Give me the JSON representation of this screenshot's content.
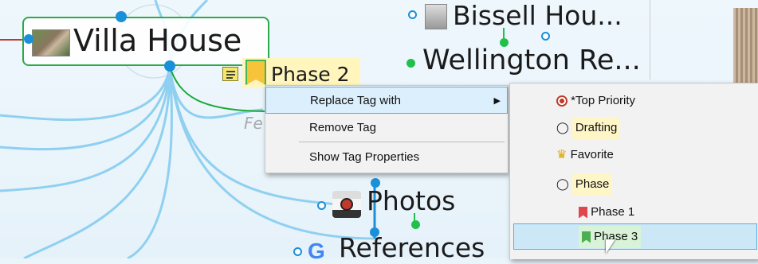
{
  "map": {
    "central_title": "Villa House",
    "nodes": {
      "bissell": "Bissell Hou...",
      "wellington": "Wellington Re...",
      "photos": "Photos",
      "references": "References",
      "phase2": "Phase 2",
      "fe_partial": "Fe"
    }
  },
  "context_menu": {
    "items": [
      {
        "label": "Replace Tag with"
      },
      {
        "label": "Remove Tag"
      },
      {
        "label": "Show Tag Properties"
      }
    ]
  },
  "submenu": {
    "items": [
      {
        "label": "*Top Priority",
        "icon": "target-icon"
      },
      {
        "label": "Drafting",
        "icon": "tag-icon"
      },
      {
        "label": "Favorite",
        "icon": "trophy-icon"
      },
      {
        "label": "Phase",
        "icon": "tag-icon"
      },
      {
        "label": "Phase 1",
        "icon": "red-bookmark-icon"
      },
      {
        "label": "Phase 3",
        "icon": "green-bookmark-icon"
      }
    ]
  },
  "colors": {
    "node_dot": "#1a90d8",
    "green_dot": "#21c04b",
    "menu_highlight": "#dceffc",
    "menu_highlight_border": "#62a9dc"
  }
}
